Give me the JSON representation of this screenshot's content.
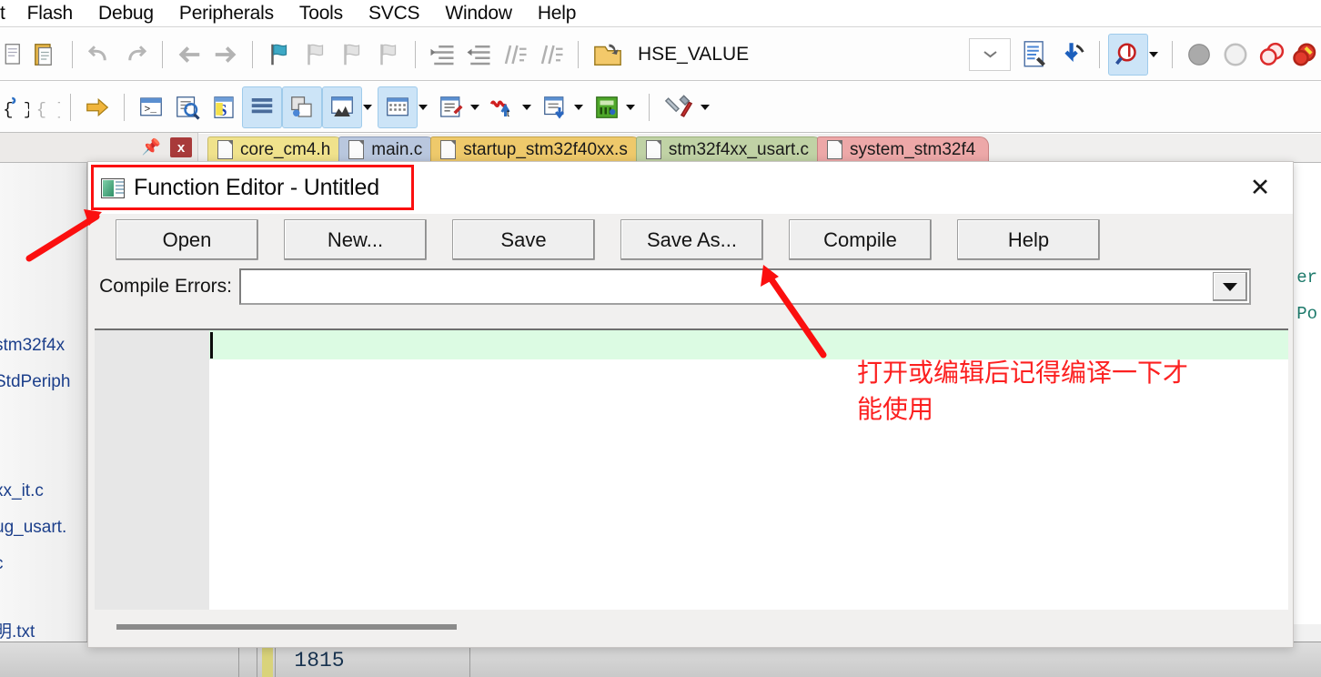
{
  "menubar": {
    "items": [
      {
        "label": "t"
      },
      {
        "label": "Flash"
      },
      {
        "label": "Debug"
      },
      {
        "label": "Peripherals"
      },
      {
        "label": "Tools"
      },
      {
        "label": "SVCS"
      },
      {
        "label": "Window"
      },
      {
        "label": "Help"
      }
    ]
  },
  "toolbar1": {
    "icons": [
      {
        "name": "copy-icon"
      },
      {
        "name": "paste-icon"
      },
      {
        "name": "undo-icon"
      },
      {
        "name": "redo-icon"
      },
      {
        "name": "navigate-back-icon"
      },
      {
        "name": "navigate-forward-icon"
      },
      {
        "name": "bookmark-toggle-icon"
      },
      {
        "name": "bookmark-prev-icon"
      },
      {
        "name": "bookmark-next-icon"
      },
      {
        "name": "bookmark-clear-icon"
      },
      {
        "name": "indent-right-icon"
      },
      {
        "name": "indent-left-icon"
      },
      {
        "name": "comment-lines-icon"
      },
      {
        "name": "uncomment-lines-icon"
      },
      {
        "name": "open-file-icon"
      }
    ],
    "search_value": "HSE_VALUE",
    "search_placeholder": "",
    "right_icons": [
      {
        "name": "find-in-files-icon"
      },
      {
        "name": "incremental-find-icon"
      },
      {
        "name": "find-magnifier-icon"
      },
      {
        "name": "breakpoint-gray-icon"
      },
      {
        "name": "breakpoint-hollow-icon"
      },
      {
        "name": "breakpoints-disable-icon"
      },
      {
        "name": "breakpoints-kill-icon"
      }
    ]
  },
  "toolbar2": {
    "icons": [
      {
        "name": "insert-brace-icon"
      },
      {
        "name": "remove-brace-icon"
      },
      {
        "name": "run-to-cursor-icon"
      },
      {
        "name": "command-window-icon"
      },
      {
        "name": "disassembly-window-icon"
      },
      {
        "name": "symbols-window-icon"
      },
      {
        "name": "registers-window-icon"
      },
      {
        "name": "call-stack-window-icon"
      },
      {
        "name": "watch-window-icon"
      },
      {
        "name": "memory-window-icon"
      },
      {
        "name": "serial-window-icon"
      },
      {
        "name": "analysis-window-icon"
      },
      {
        "name": "trace-window-icon"
      },
      {
        "name": "system-viewer-icon"
      },
      {
        "name": "toolbox-icon"
      }
    ]
  },
  "panel": {
    "pin_icon": "pin-icon",
    "close_label": "x"
  },
  "tabs": [
    {
      "label": "core_cm4.h",
      "color": "#f0e28c",
      "border": "#c8bb6b"
    },
    {
      "label": "main.c",
      "color": "#b9c7de",
      "border": "#8d9cb7"
    },
    {
      "label": "startup_stm32f40xx.s",
      "color": "#eec96b",
      "border": "#c4a34c"
    },
    {
      "label": "stm32f4xx_usart.c",
      "color": "#c0d2a5",
      "border": "#9bb07c"
    },
    {
      "label": "system_stm32f4",
      "color": "#eda8a8",
      "border": "#c78383"
    }
  ],
  "project_tree": {
    "items": [
      {
        "label": "stm32f4x"
      },
      {
        "label": "StdPeriph"
      },
      {
        "label": "xx_it.c"
      },
      {
        "label": "ug_usart."
      },
      {
        "label": "c"
      },
      {
        "label": "明.txt"
      }
    ]
  },
  "editor_bg": {
    "code_fragments": [
      {
        "text": "er"
      },
      {
        "text": "Po"
      },
      {
        "text": "\\r"
      }
    ],
    "line_number": "1815"
  },
  "dialog": {
    "title": "Function Editor - Untitled",
    "icon": "function-editor-icon",
    "close_icon": "close-icon",
    "buttons": [
      {
        "label": "Open",
        "name": "open-button"
      },
      {
        "label": "New...",
        "name": "new-button"
      },
      {
        "label": "Save",
        "name": "save-button"
      },
      {
        "label": "Save As...",
        "name": "save-as-button"
      },
      {
        "label": "Compile",
        "name": "compile-button"
      },
      {
        "label": "Help",
        "name": "help-button"
      }
    ],
    "compile_errors": {
      "label": "Compile Errors:",
      "value": "",
      "placeholder": ""
    },
    "editor": {
      "content": "",
      "current_line_color": "#dcfbe3"
    }
  },
  "annotations": {
    "accent_color": "#fb0f0f",
    "note_text": "打开或编辑后记得编译一下才\n能使用",
    "title_highlight_name": "title-highlight-box"
  }
}
